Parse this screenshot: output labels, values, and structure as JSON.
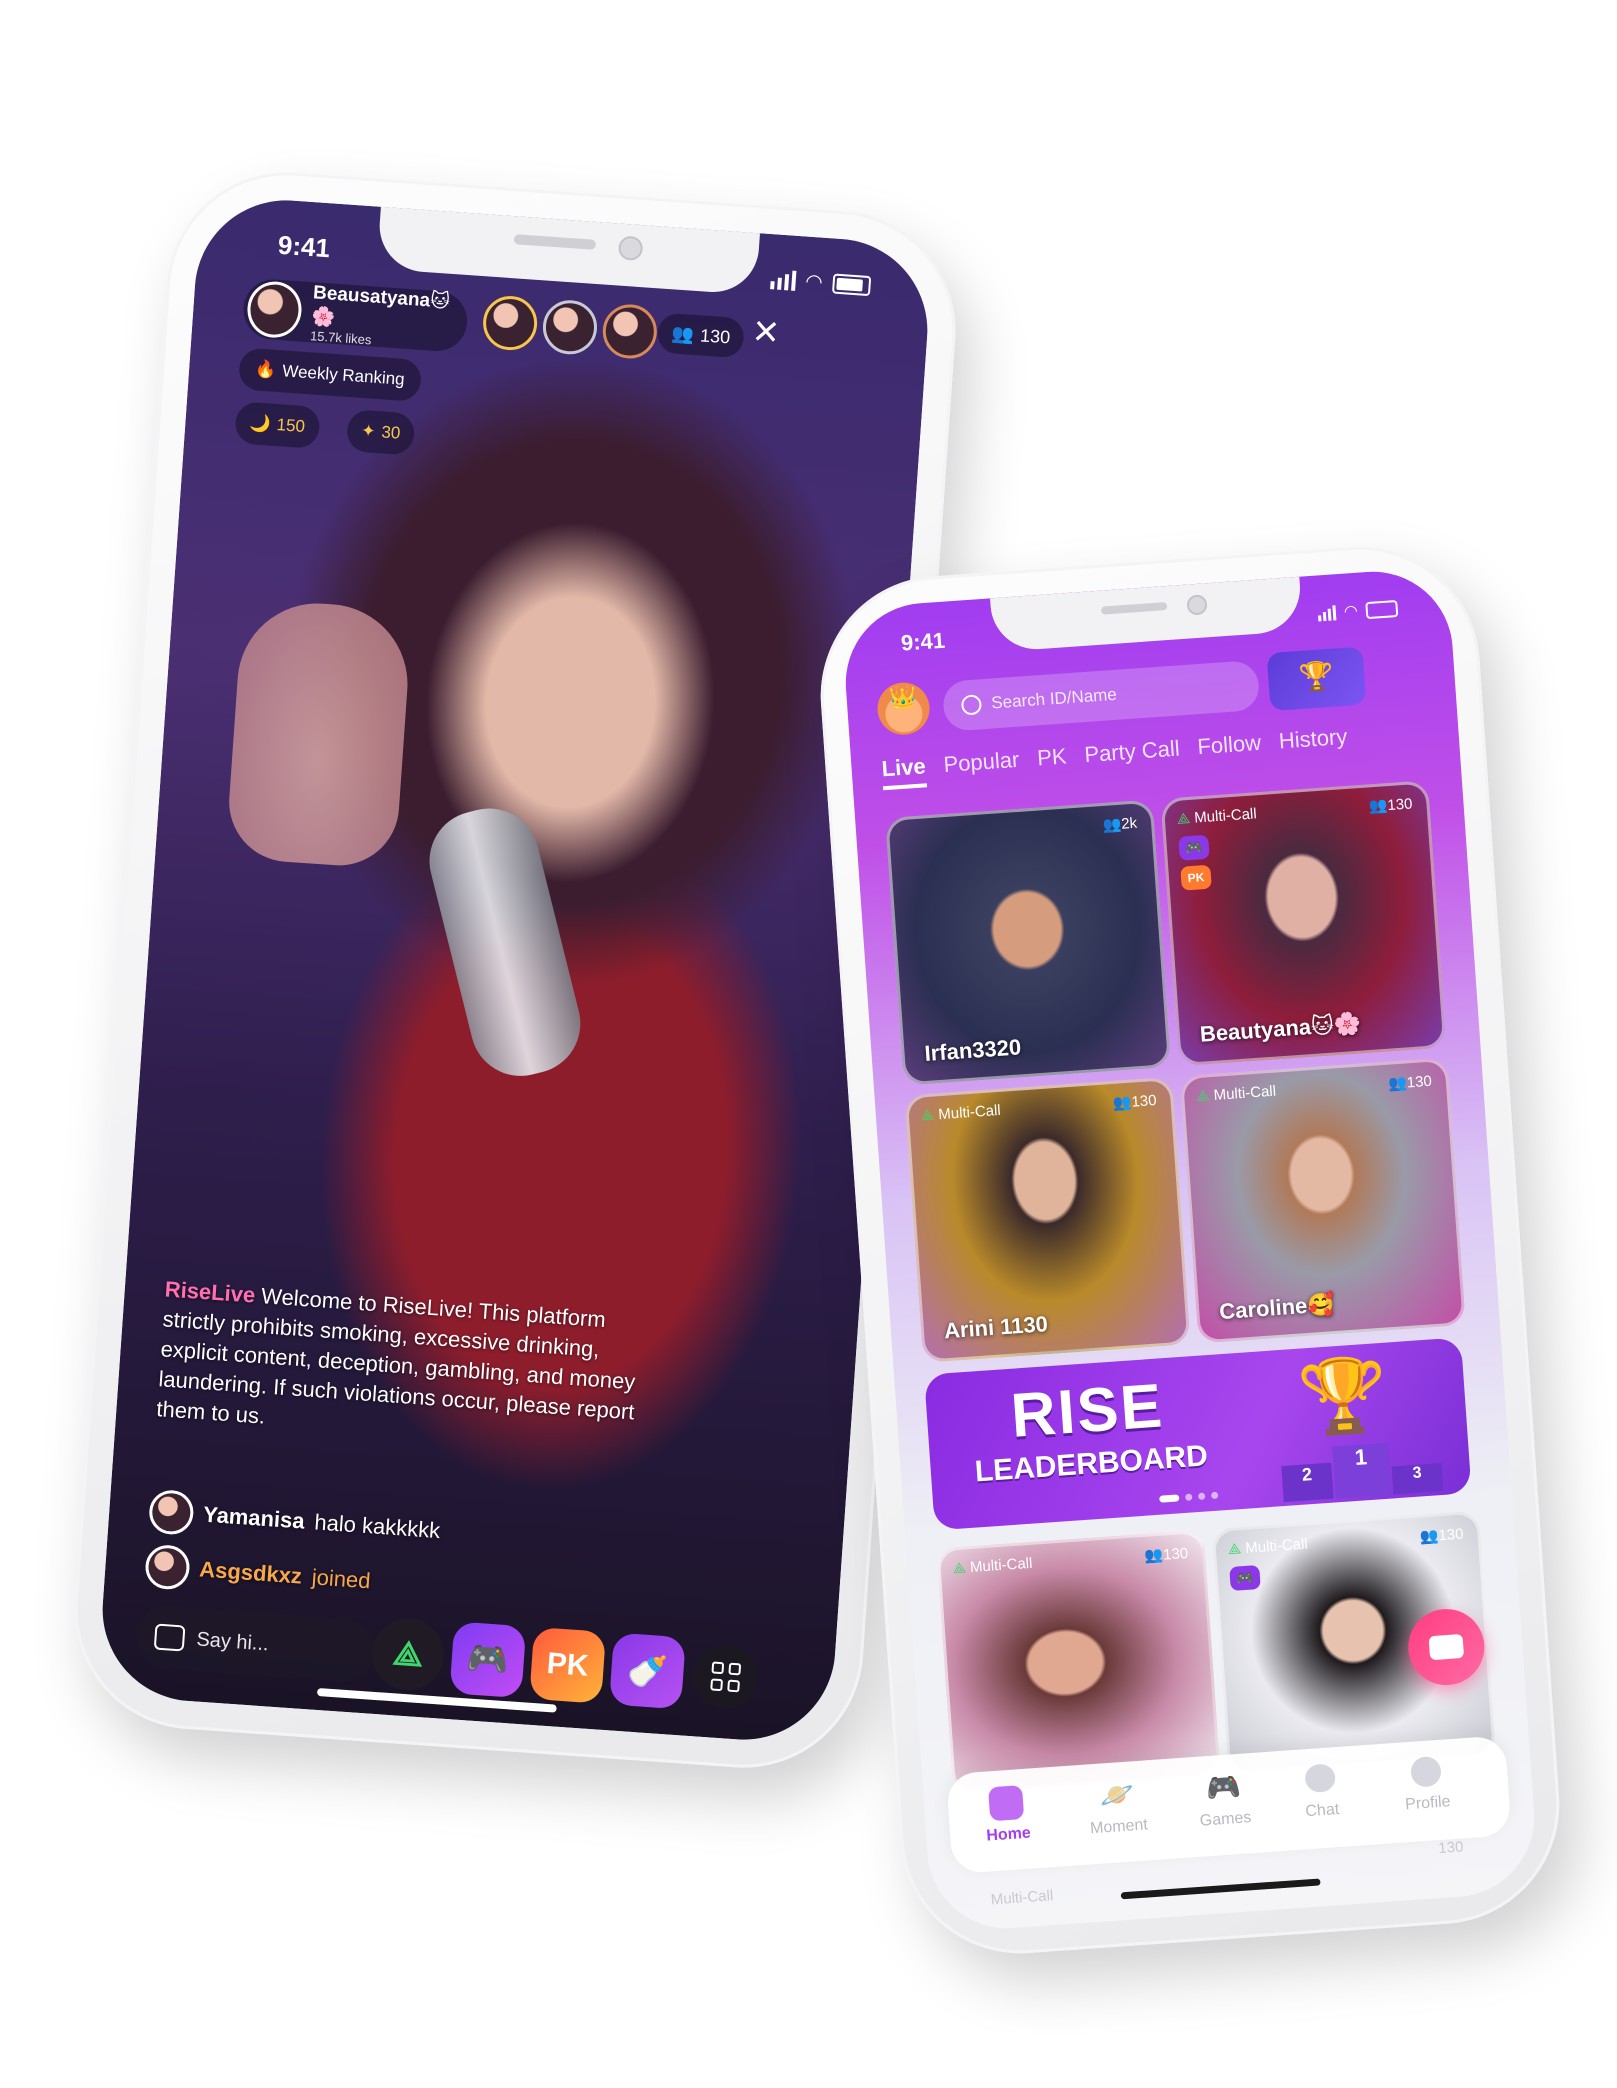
{
  "left_phone": {
    "status_time": "9:41",
    "host": {
      "name": "Beausatyana🐱🌸",
      "likes": "15.7k likes"
    },
    "viewer_count": "130",
    "weekly_ranking": "Weekly Ranking",
    "coins": "150",
    "stars": "30",
    "chat": {
      "system_brand": "RiseLive",
      "system_message": "Welcome to RiseLive! This platform strictly prohibits smoking, excessive drinking, explicit content, deception, gambling, and money laundering. If such violations occur, please report them to us.",
      "message_user": "Yamanisa",
      "message_text": "halo kakkkkk",
      "joined_user": "Asgsdkxz",
      "joined_text": "joined"
    },
    "input_placeholder": "Say hi...",
    "pk_label": "PK"
  },
  "right_phone": {
    "status_time": "9:41",
    "search_placeholder": "Search ID/Name",
    "tabs": [
      "Live",
      "Popular",
      "PK",
      "Party Call",
      "Follow",
      "History"
    ],
    "active_tab": "Live",
    "cards": [
      {
        "name": "Irfan3320",
        "viewers": "2k",
        "multi": ""
      },
      {
        "name": "Beautyana🐱🌸",
        "viewers": "130",
        "multi": "Multi-Call",
        "badge": "PK"
      },
      {
        "name": "Arini 1130",
        "viewers": "130",
        "multi": "Multi-Call"
      },
      {
        "name": "Caroline🥰",
        "viewers": "130",
        "multi": "Multi-Call"
      },
      {
        "name": "",
        "viewers": "130",
        "multi": "Multi-Call"
      },
      {
        "name": "",
        "viewers": "130",
        "multi": "Multi-Call"
      }
    ],
    "banner": {
      "line1": "RISE",
      "line2": "LEADERBOARD",
      "podium": [
        "2",
        "1",
        "3"
      ]
    },
    "bottom_nav": [
      "Home",
      "Moment",
      "Games",
      "Chat",
      "Profile"
    ],
    "active_nav": "Home",
    "peek_multi": "Multi-Call",
    "peek_viewers": "130"
  },
  "colors": {
    "accent": "#a53df0",
    "pink": "#ff4fa3",
    "gold": "#f7c64a",
    "pk_orange": "#ff7a2e"
  }
}
